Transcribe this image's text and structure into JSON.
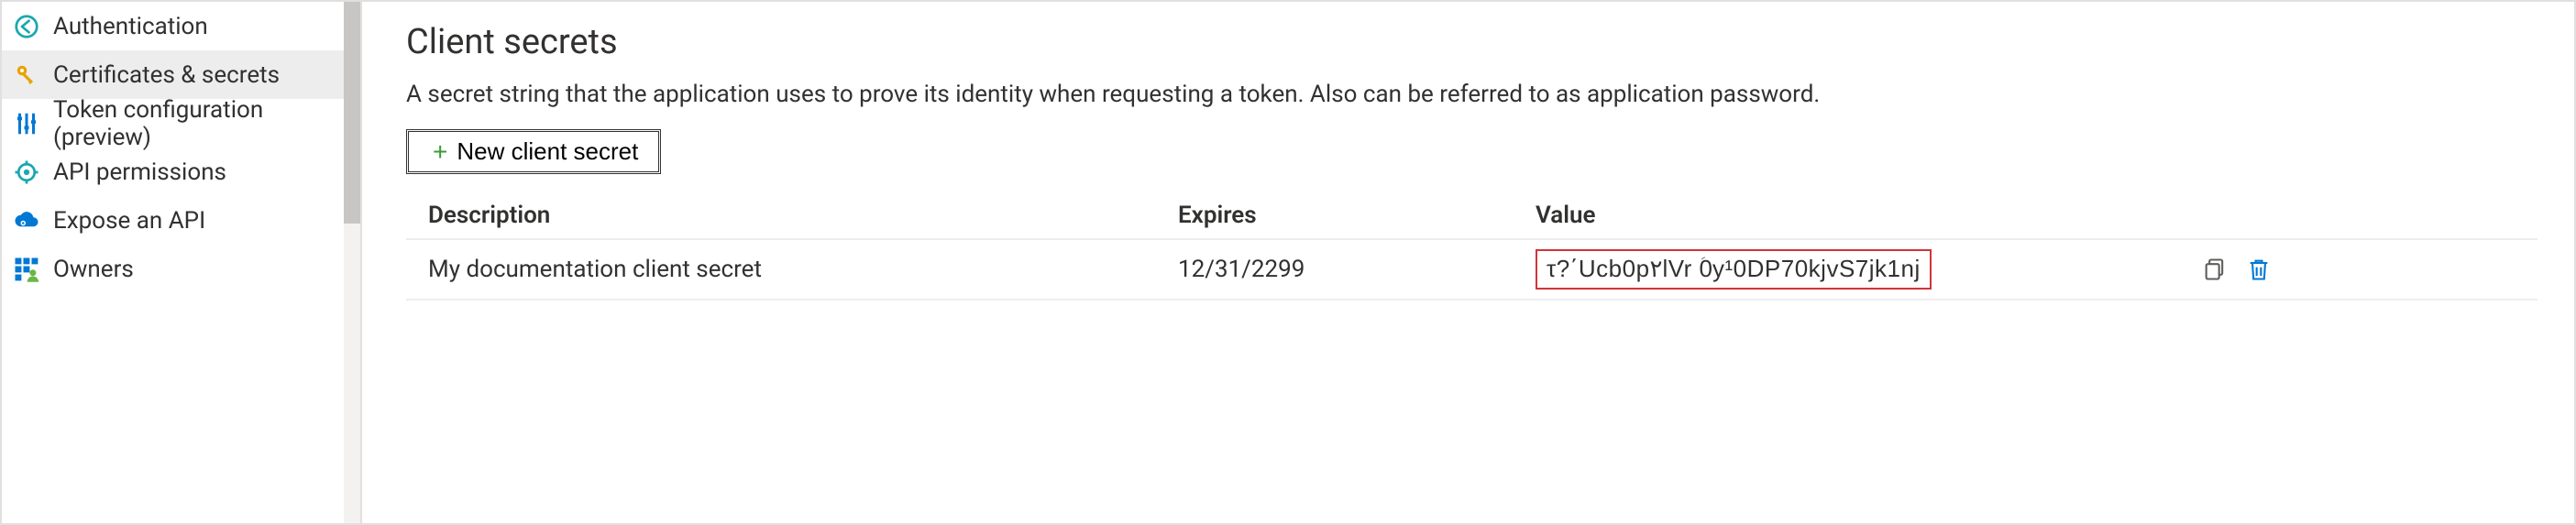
{
  "sidebar": {
    "items": [
      {
        "label": "Authentication",
        "icon": "auth-icon",
        "active": false
      },
      {
        "label": "Certificates & secrets",
        "icon": "key-icon",
        "active": true
      },
      {
        "label": "Token configuration (preview)",
        "icon": "sliders-icon",
        "active": false
      },
      {
        "label": "API permissions",
        "icon": "api-perm-icon",
        "active": false
      },
      {
        "label": "Expose an API",
        "icon": "cloud-gear-icon",
        "active": false
      },
      {
        "label": "Owners",
        "icon": "grid-person-icon",
        "active": false
      }
    ]
  },
  "main": {
    "title": "Client secrets",
    "description": "A secret string that the application uses to prove its identity when requesting a token. Also can be referred to as application password.",
    "new_button_label": "New client secret",
    "table": {
      "headers": {
        "description": "Description",
        "expires": "Expires",
        "value": "Value"
      },
      "rows": [
        {
          "description": "My documentation client secret",
          "expires": "12/31/2299",
          "value": "τ?΄Ucb0p٢lVr ؘ0y¹0DP70kjvS7jk1nj"
        }
      ]
    }
  },
  "colors": {
    "key": "#e8a300",
    "api": "#1ba7b0",
    "cloud": "#0078d4",
    "grid": "#0078d4",
    "plus": "#3c9b35",
    "delete": "#0078d4",
    "copy": "#605e5c",
    "highlight_border": "#d13438"
  }
}
